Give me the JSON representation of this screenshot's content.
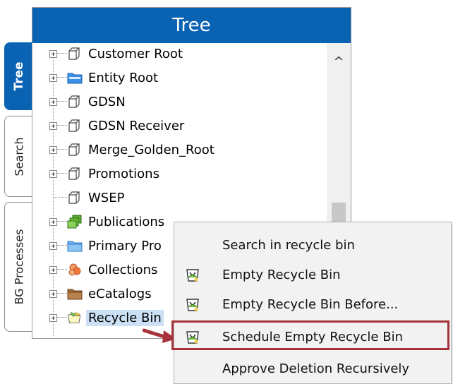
{
  "side_tabs": [
    {
      "label": "Tree",
      "active": true
    },
    {
      "label": "Search",
      "active": false
    },
    {
      "label": "BG Processes",
      "active": false
    }
  ],
  "panel": {
    "title": "Tree"
  },
  "tree": {
    "items": [
      {
        "label": "Customer Root",
        "icon": "folder-outline-icon"
      },
      {
        "label": "Entity Root",
        "icon": "entity-folder-icon"
      },
      {
        "label": "GDSN",
        "icon": "folder-outline-icon"
      },
      {
        "label": "GDSN Receiver",
        "icon": "folder-outline-icon"
      },
      {
        "label": "Merge_Golden_Root",
        "icon": "folder-outline-icon"
      },
      {
        "label": "Promotions",
        "icon": "folder-outline-icon"
      },
      {
        "label": "WSEP",
        "icon": "folder-outline-icon"
      },
      {
        "label": "Publications",
        "icon": "publications-icon"
      },
      {
        "label": "Primary Pro",
        "icon": "blue-folder-icon"
      },
      {
        "label": "Collections",
        "icon": "collections-icon"
      },
      {
        "label": "eCatalogs",
        "icon": "catalog-folder-icon"
      },
      {
        "label": "Recycle Bin",
        "icon": "recycle-bin-icon",
        "selected": true
      }
    ]
  },
  "scrollbar": {
    "up_arrow": "^"
  },
  "context_menu": {
    "items": [
      {
        "label": "Search in recycle bin",
        "icon": ""
      },
      {
        "label": "Empty Recycle Bin",
        "icon": "empty-bin-icon"
      },
      {
        "label": "Empty Recycle Bin Before...",
        "icon": "empty-bin-icon"
      },
      {
        "label": "Schedule Empty Recycle Bin",
        "icon": "empty-bin-icon",
        "highlighted": true
      },
      {
        "label": "Approve Deletion Recursively",
        "icon": ""
      }
    ]
  },
  "colors": {
    "header_blue": "#0a62b3",
    "selection": "#cce0f5",
    "highlight_border": "#a6323a",
    "menu_bg": "#f2f2f2"
  }
}
